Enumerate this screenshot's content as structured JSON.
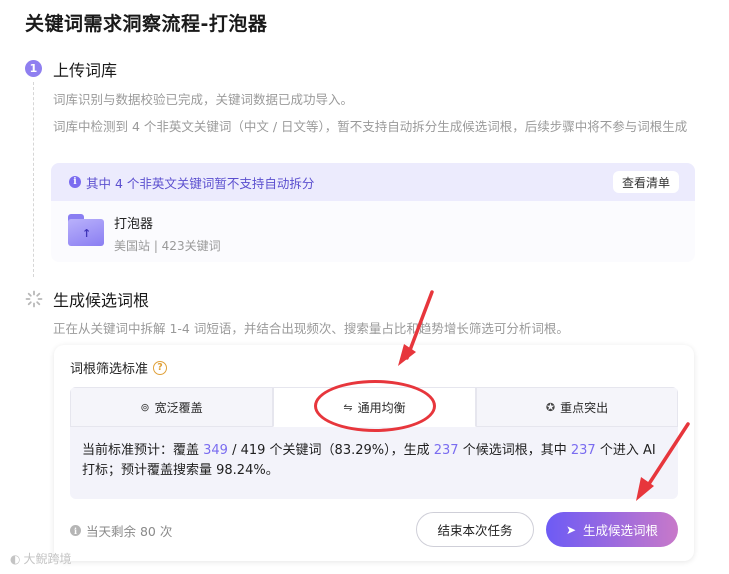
{
  "page": {
    "title": "关键词需求洞察流程-打泡器"
  },
  "step1": {
    "number": "1",
    "title": "上传词库",
    "desc1": "词库识别与数据校验已完成，关键词数据已成功导入。",
    "desc2": "词库中检测到 4 个非英文关键词（中文 / 日文等），暂不支持自动拆分生成候选词根，后续步骤中将不参与词根生成",
    "notice": "其中 4 个非英文关键词暂不支持自动拆分",
    "view_list": "查看清单",
    "file_name": "打泡器",
    "file_meta": "美国站 | 423关键词"
  },
  "step2": {
    "title": "生成候选词根",
    "desc": "正在从关键词中拆解 1-4 词短语，并结合出现频次、搜索量占比和趋势增长筛选可分析词根。",
    "criteria_label": "词根筛选标准",
    "tabs": [
      {
        "label": "宽泛覆盖",
        "icon": "⊚"
      },
      {
        "label": "通用均衡",
        "icon": "⇋"
      },
      {
        "label": "重点突出",
        "icon": "✪"
      }
    ],
    "stats": {
      "p1": "当前标准预计：覆盖 ",
      "covered": "349",
      "p2": " / 419 个关键词（83.29%），生成 ",
      "generated": "237",
      "p3": " 个候选词根，其中 ",
      "ai": "237",
      "p4": " 个进入 AI 打标；预计覆盖搜索量 98.24%。"
    },
    "quota": "当天剩余 80 次",
    "end_task": "结束本次任务",
    "generate": "生成候选词根"
  },
  "watermark": "大鲵跨境",
  "colors": {
    "accent": "#7a6cf0",
    "annotation": "#e7363c"
  }
}
